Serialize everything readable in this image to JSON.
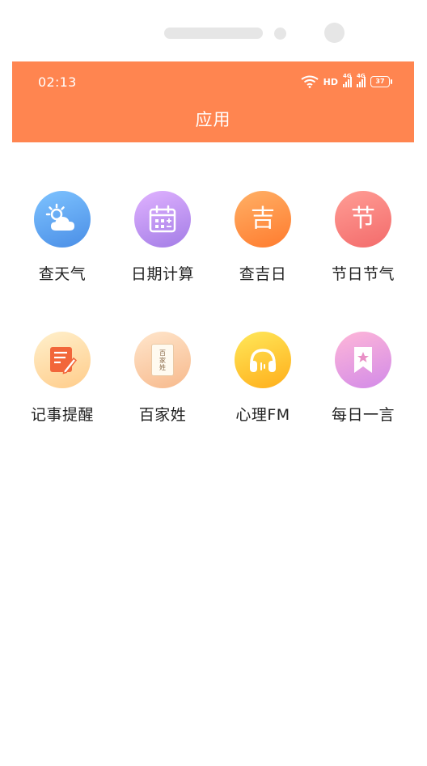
{
  "status_bar": {
    "time": "02:13",
    "hd_label": "HD",
    "signal_1_label": "4G",
    "signal_2_label": "4G",
    "battery": "37"
  },
  "header": {
    "title": "应用"
  },
  "apps": [
    {
      "label": "查天气",
      "icon": "weather-icon",
      "glyph": ""
    },
    {
      "label": "日期计算",
      "icon": "calendar-icon",
      "glyph": ""
    },
    {
      "label": "查吉日",
      "icon": "lucky-day-icon",
      "glyph": "吉"
    },
    {
      "label": "节日节气",
      "icon": "festival-icon",
      "glyph": "节"
    },
    {
      "label": "记事提醒",
      "icon": "note-icon",
      "glyph": ""
    },
    {
      "label": "百家姓",
      "icon": "surname-book-icon",
      "glyph": "百家姓"
    },
    {
      "label": "心理FM",
      "icon": "headphones-icon",
      "glyph": ""
    },
    {
      "label": "每日一言",
      "icon": "bookmark-star-icon",
      "glyph": ""
    }
  ],
  "colors": {
    "accent": "#ff8550"
  }
}
